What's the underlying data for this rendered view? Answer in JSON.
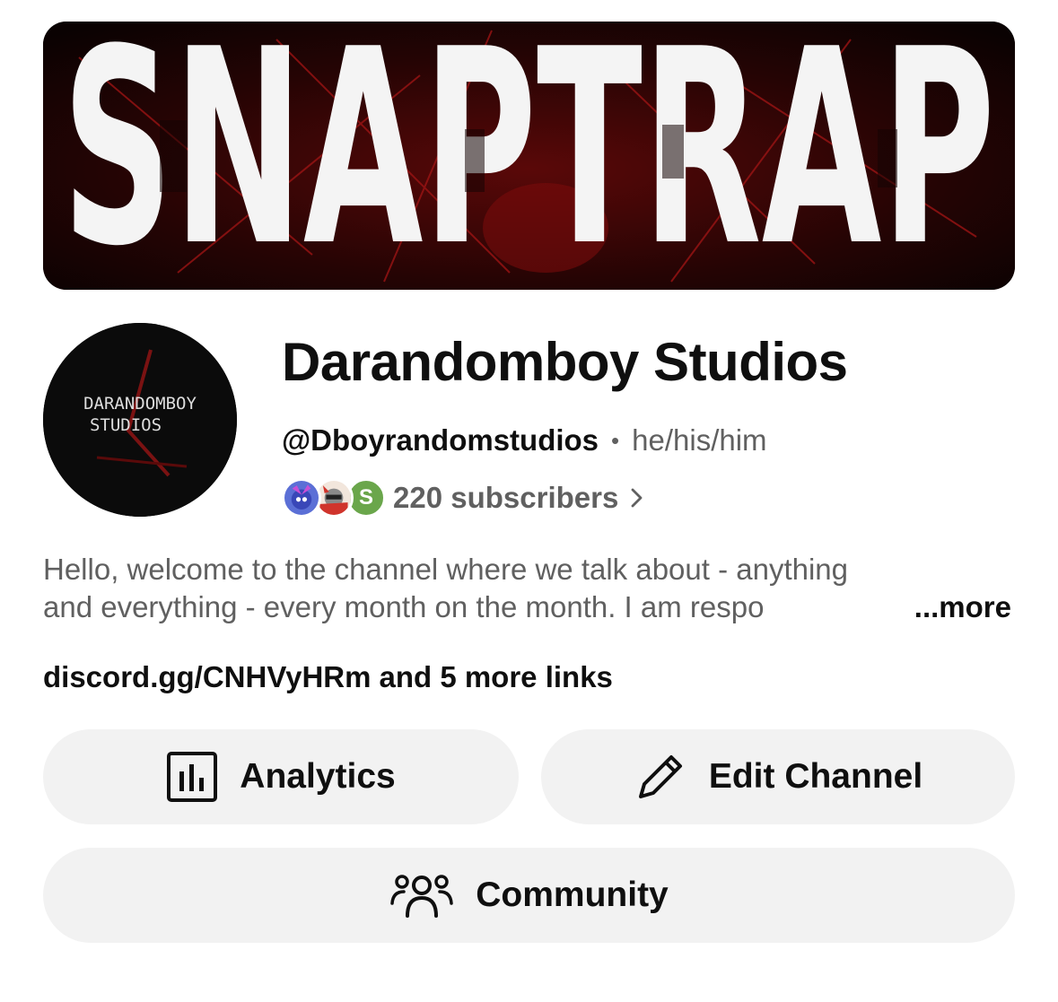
{
  "banner": {
    "text": "SNAPTRAP",
    "colors": {
      "background": "#140404",
      "accent": "#8b1010",
      "letters": "#f4f4f4"
    }
  },
  "avatar": {
    "line1": "DARANDOMBOY",
    "line2": "STUDIOS"
  },
  "channel": {
    "name": "Darandomboy Studios",
    "handle": "@Dboyrandomstudios",
    "separator": "•",
    "pronouns": "he/his/him",
    "subscribers": "220 subscribers",
    "subscriber_avatars": [
      {
        "icon": "hedgehog-avatar-icon"
      },
      {
        "icon": "raccoon-avatar-icon"
      },
      {
        "letter": "S",
        "color": "#6aa64b"
      }
    ]
  },
  "description": {
    "line1": "Hello, welcome to the channel where we talk about - anything",
    "line2": "and everything - every month on the month. I am respo",
    "more": "...more"
  },
  "links": {
    "primary": "discord.gg/CNHVyHRm",
    "suffix": "and 5 more links"
  },
  "actions": {
    "analytics": {
      "label": "Analytics",
      "icon": "bar-chart-icon"
    },
    "edit": {
      "label": "Edit Channel",
      "icon": "pencil-icon"
    },
    "community": {
      "label": "Community",
      "icon": "people-icon"
    }
  },
  "colors": {
    "primary_text": "#0f0f0f",
    "secondary_text": "#606060",
    "button_bg": "#f2f2f2"
  }
}
